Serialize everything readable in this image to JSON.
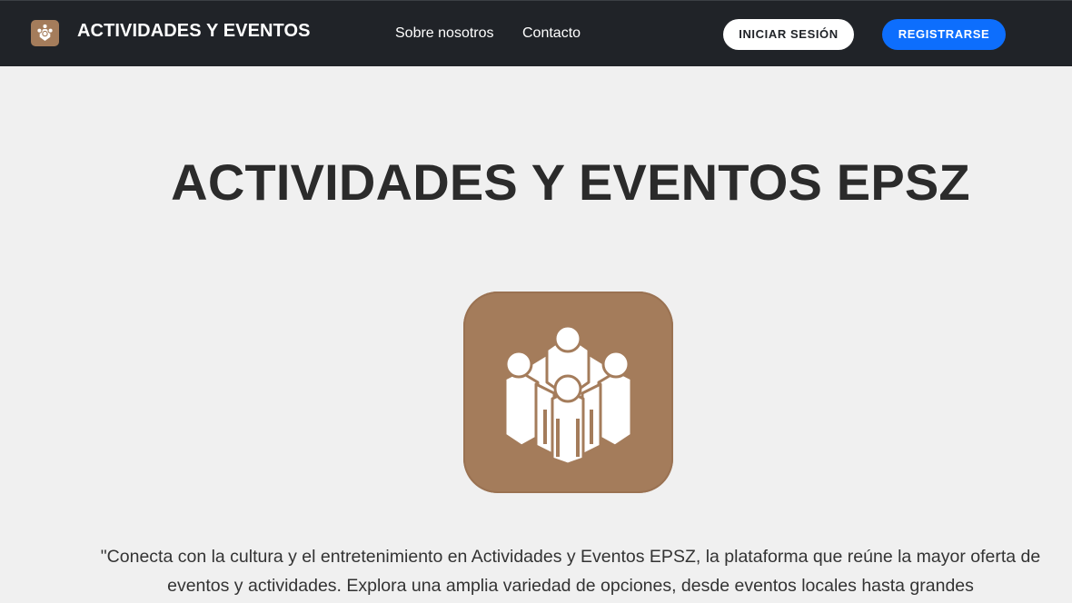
{
  "navbar": {
    "brand_title": "ACTIVIDADES Y EVENTOS",
    "links": [
      {
        "label": "Sobre nosotros"
      },
      {
        "label": "Contacto"
      }
    ],
    "login_label": "INICIAR SESIÓN",
    "register_label": "REGISTRARSE",
    "logo_icon": "community-people-icon"
  },
  "hero": {
    "title": "ACTIVIDADES Y EVENTOS EPSZ",
    "logo_icon": "community-people-icon",
    "description": "\"Conecta con la cultura y el entretenimiento en Actividades y Eventos EPSZ, la plataforma que reúne la mayor oferta de eventos y actividades. Explora una amplia variedad de opciones, desde eventos locales hasta grandes"
  },
  "colors": {
    "navbar_bg": "#202328",
    "page_bg": "#f0f0f0",
    "brand_brown": "#a47c5b",
    "primary_blue": "#0d6efd"
  }
}
